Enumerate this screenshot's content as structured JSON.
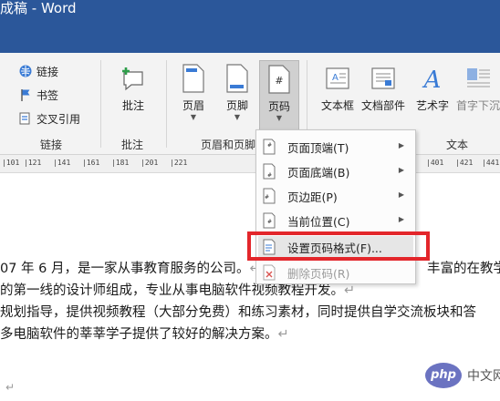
{
  "window": {
    "title": "成稿  -  Word"
  },
  "ribbon": {
    "links": {
      "hyperlink": "链接",
      "bookmark": "书签",
      "cross_reference": "交叉引用",
      "group": "链接"
    },
    "comments": {
      "comment": "批注",
      "group": "批注"
    },
    "header_footer": {
      "header": "页眉",
      "footer": "页脚",
      "page_number": "页码",
      "group": "页眉和页脚"
    },
    "text": {
      "textbox": "文本框",
      "quick_parts": "文档部件",
      "wordart": "艺术字",
      "dropcap": "首字下沉",
      "group": "文本"
    }
  },
  "ruler": {
    "ticks": [
      "|101",
      "|121",
      "|141",
      "|161",
      "|181",
      "|201",
      "|221",
      "|401",
      "|421",
      "|441"
    ]
  },
  "menu": {
    "items": [
      {
        "label": "页面顶端(T)",
        "arrow": "▶"
      },
      {
        "label": "页面底端(B)",
        "arrow": "▶"
      },
      {
        "label": "页边距(P)",
        "arrow": "▶"
      },
      {
        "label": "当前位置(C)",
        "arrow": "▶"
      },
      {
        "label": "设置页码格式(F)..."
      },
      {
        "label": "删除页码(R)"
      }
    ]
  },
  "document": {
    "lines": [
      "07 年 6 月，是一家从事教育服务的公司。",
      "的第一线的设计师组成，专业从事电脑软件视频教程开发。",
      "规划指导，提供视频教程（大部分免费）和练习素材，同时提供自学交流板块和答",
      "多电脑软件的莘莘学子提供了较好的解决方案。"
    ],
    "line1_tail": "丰富的在教学第",
    "paragraph_mark": "↵"
  },
  "watermark": {
    "badge": "php",
    "text": "中文网"
  }
}
